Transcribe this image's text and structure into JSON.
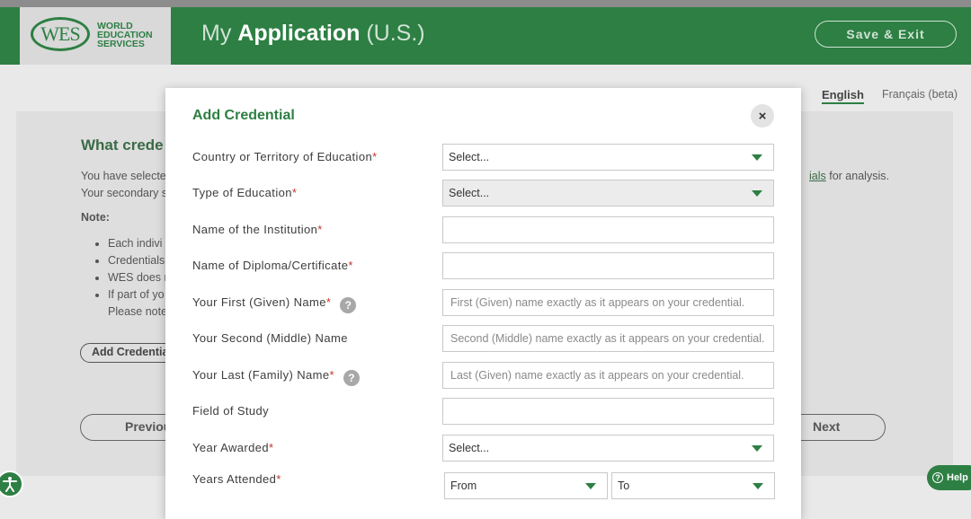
{
  "header": {
    "logo_mark": "WES",
    "logo_line1": "WORLD",
    "logo_line2": "EDUCATION",
    "logo_line3": "SERVICES",
    "title_prefix": "My",
    "title_bold": "Application",
    "title_suffix": "(U.S.)",
    "save_exit_label": "Save & Exit"
  },
  "language": {
    "english": "English",
    "french": "Français (beta)"
  },
  "background": {
    "heading": "What crede",
    "line1": "You have selecte",
    "line1_link": "ials",
    "line1_end": "for analysis.",
    "line2": "Your secondary s",
    "note_label": "Note:",
    "bullets": [
      "Each indivi",
      "Credentials",
      "WES does n",
      "If part of yo"
    ],
    "bullet_cont": "Please note",
    "add_credential": "Add Credential",
    "previous": "Previous",
    "next": "Next"
  },
  "modal": {
    "title": "Add Credential",
    "close_symbol": "×",
    "fields": [
      {
        "label": "Country or Territory of Education",
        "required": "*",
        "value": "Select..."
      },
      {
        "label": "Type of Education",
        "required": "*",
        "value": "Select..."
      },
      {
        "label": "Name of the Institution",
        "required": "*",
        "value": ""
      },
      {
        "label": "Name of Diploma/Certificate",
        "required": "*",
        "value": ""
      },
      {
        "label": "Your First (Given) Name",
        "required": "*",
        "help": "?",
        "placeholder": "First (Given) name exactly as it appears on your credential."
      },
      {
        "label": "Your Second (Middle) Name",
        "required": "",
        "placeholder": "Second (Middle) name exactly as it appears on your credential."
      },
      {
        "label": "Your Last (Family) Name",
        "required": "*",
        "help": "?",
        "placeholder": "Last (Given) name exactly as it appears on your credential."
      },
      {
        "label": "Field of Study",
        "required": "",
        "value": ""
      },
      {
        "label": "Year Awarded",
        "required": "*",
        "value": "Select..."
      },
      {
        "label": "Years Attended",
        "required": "*",
        "from": "From",
        "to": "To"
      }
    ]
  },
  "help_button": {
    "label": "Help",
    "icon": "?"
  },
  "accessibility": {
    "icon": "accessibility-icon"
  },
  "colors": {
    "brand_green": "#2d7f43",
    "required_red": "#c0392b"
  }
}
